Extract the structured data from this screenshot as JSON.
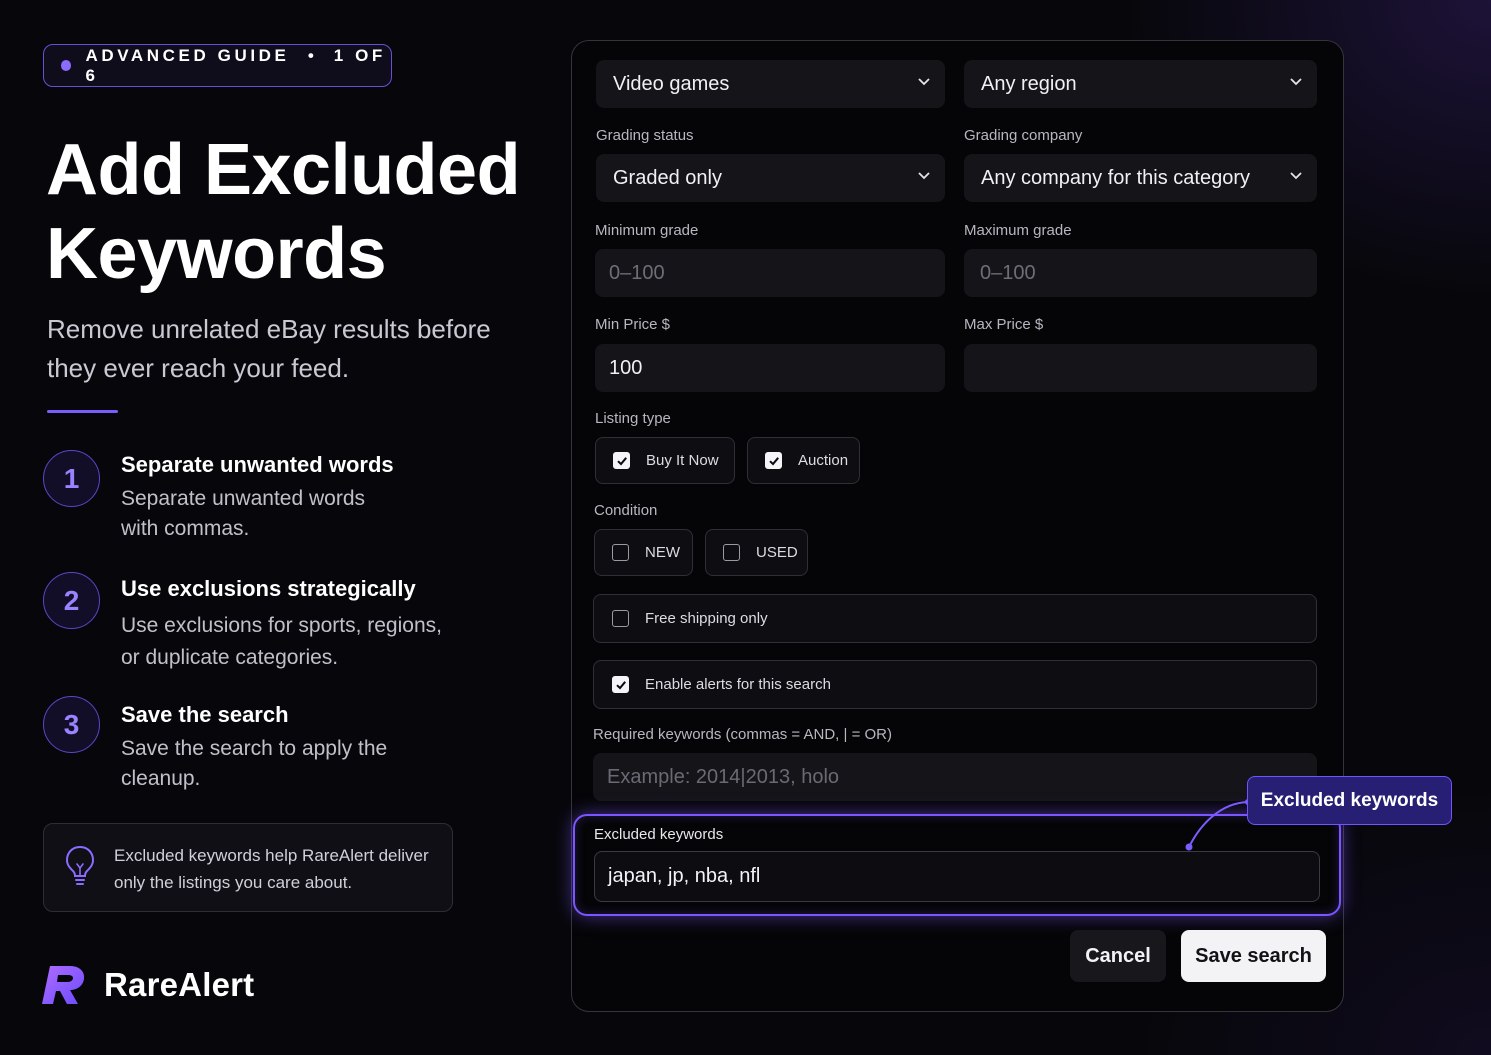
{
  "badge": {
    "label": "ADVANCED GUIDE",
    "separator": "•",
    "progress": "1 OF 6"
  },
  "hero": {
    "title_line1": "Add Excluded",
    "title_line2": "Keywords",
    "subtitle": "Remove unrelated eBay results before they ever reach your feed."
  },
  "steps": [
    {
      "number": "1",
      "title": "Separate unwanted words",
      "description": "Separate unwanted words with commas."
    },
    {
      "number": "2",
      "title": "Use exclusions strategically",
      "description": "Use exclusions for sports, regions, or duplicate categories."
    },
    {
      "number": "3",
      "title": "Save the search",
      "description": "Save the search to apply the cleanup."
    }
  ],
  "tip": {
    "text": "Excluded keywords help RareAlert deliver only the listings you care about.",
    "icon": "lightbulb-icon"
  },
  "brand": {
    "name": "RareAlert",
    "logo": "rarealert-logo"
  },
  "form": {
    "category": {
      "value": "Video games"
    },
    "region": {
      "value": "Any region"
    },
    "grading_status": {
      "label": "Grading status",
      "value": "Graded only"
    },
    "grading_company": {
      "label": "Grading company",
      "value": "Any company for this category"
    },
    "min_grade": {
      "label": "Minimum grade",
      "value": "",
      "placeholder": "0–100"
    },
    "max_grade": {
      "label": "Maximum grade",
      "value": "",
      "placeholder": "0–100"
    },
    "min_price": {
      "label": "Min Price $",
      "value": "100"
    },
    "max_price": {
      "label": "Max Price $",
      "value": ""
    },
    "listing_type": {
      "label": "Listing type",
      "options": [
        {
          "label": "Buy It Now",
          "checked": true
        },
        {
          "label": "Auction",
          "checked": true
        }
      ]
    },
    "condition": {
      "label": "Condition",
      "options": [
        {
          "label": "NEW",
          "checked": false
        },
        {
          "label": "USED",
          "checked": false
        }
      ]
    },
    "free_shipping": {
      "label": "Free shipping only",
      "checked": false
    },
    "enable_alerts": {
      "label": "Enable alerts for this search",
      "checked": true
    },
    "required_keywords": {
      "label": "Required keywords (commas = AND, | = OR)",
      "value": "",
      "placeholder": "Example: 2014|2013, holo"
    },
    "excluded_keywords": {
      "label": "Excluded keywords",
      "value": "japan, jp, nba, nfl"
    },
    "cancel_label": "Cancel",
    "save_label": "Save search"
  },
  "callout": {
    "label": "Excluded keywords"
  },
  "colors": {
    "accent": "#7b55ff",
    "accent_light": "#9b82ff",
    "callout_bg": "#271f74",
    "background": "#07070b"
  }
}
